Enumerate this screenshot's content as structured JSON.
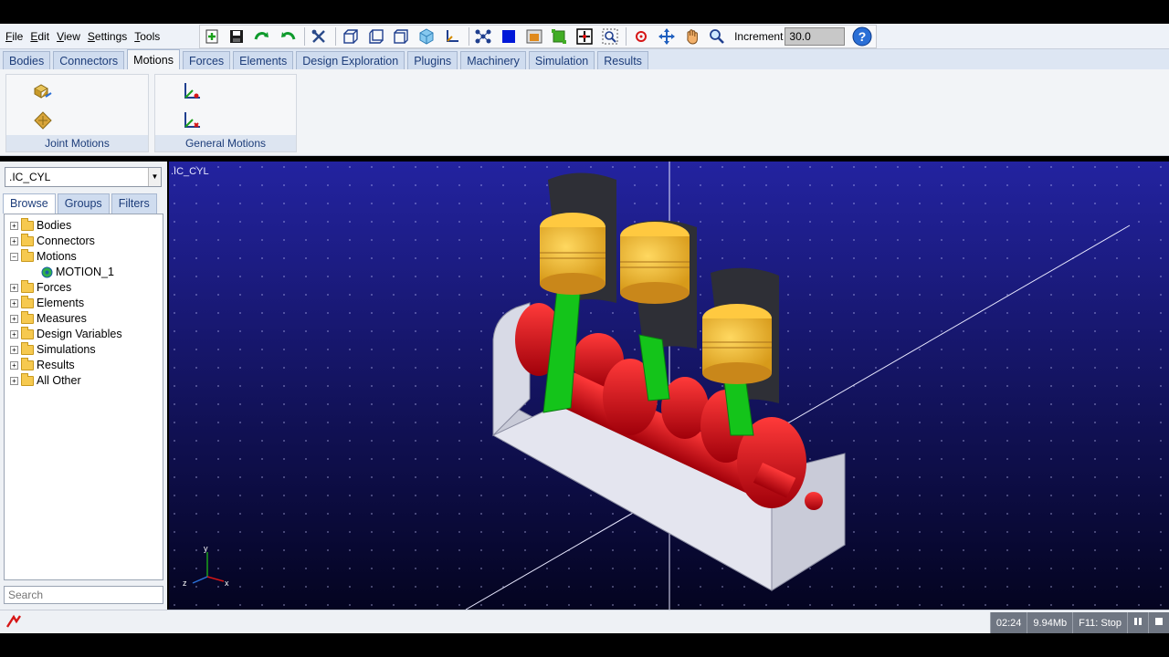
{
  "menu": {
    "items": [
      "File",
      "Edit",
      "View",
      "Settings",
      "Tools"
    ]
  },
  "toolbar": {
    "increment_label": "Increment",
    "increment_value": "30.0"
  },
  "tabs": [
    "Bodies",
    "Connectors",
    "Motions",
    "Forces",
    "Elements",
    "Design Exploration",
    "Plugins",
    "Machinery",
    "Simulation",
    "Results"
  ],
  "ribbon": {
    "group1_label": "Joint Motions",
    "group2_label": "General Motions"
  },
  "leftpanel": {
    "model": ".IC_CYL",
    "subtabs": [
      "Browse",
      "Groups",
      "Filters"
    ],
    "tree": [
      "Bodies",
      "Connectors",
      "Motions",
      "MOTION_1",
      "Forces",
      "Elements",
      "Measures",
      "Design Variables",
      "Simulations",
      "Results",
      "All Other"
    ],
    "search": "Search"
  },
  "viewport": {
    "title": ".IC_CYL",
    "axes": {
      "x": "x",
      "y": "y",
      "z": "z"
    }
  },
  "status": {
    "time": "02:24",
    "memory": "9.94Mb",
    "hint": "F11: Stop"
  },
  "colors": {
    "piston": "#f2b734",
    "crank": "#e0101c",
    "rod": "#14c41a",
    "sleeve": "#2e2f36",
    "frame": "#d7d9e6",
    "viewport_top": "#2323a0",
    "viewport_bottom": "#040420"
  }
}
